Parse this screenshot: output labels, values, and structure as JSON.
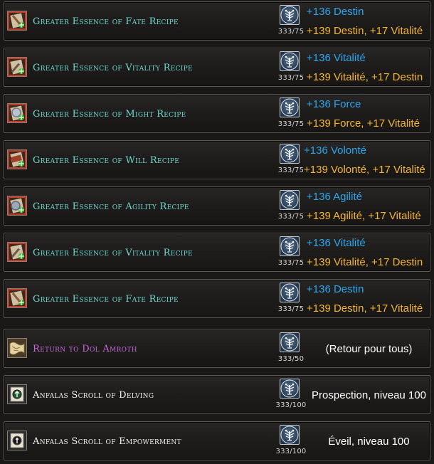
{
  "items": [
    {
      "name": "Greater Essence of Fate Recipe",
      "name_color": "teal",
      "icon": "fate-recipe-icon",
      "emblem": "white-tree-emblem-icon",
      "count": "333/75",
      "bonus1": "+136 Destin",
      "bonus2": "+139 Destin, +17 Vitalité"
    },
    {
      "name": "Greater Essence of Vitality Recipe",
      "name_color": "teal",
      "icon": "vitality-recipe-icon",
      "emblem": "white-tree-emblem-icon",
      "count": "333/75",
      "bonus1": "+136 Vitalité",
      "bonus2": "+139 Vitalité, +17 Destin"
    },
    {
      "name": "Greater Essence of Might Recipe",
      "name_color": "teal",
      "icon": "might-recipe-icon",
      "emblem": "white-tree-emblem-icon",
      "count": "333/75",
      "bonus1": "+136 Force",
      "bonus2": "+139 Force, +17 Vitalité"
    },
    {
      "name": "Greater Essence of Will Recipe",
      "name_color": "teal",
      "icon": "will-recipe-icon",
      "emblem": "white-tree-emblem-icon",
      "count": "333/75",
      "bonus1": "+136 Volonté",
      "bonus2": "+139 Volonté, +17 Vitalité"
    },
    {
      "name": "Greater Essence of Agility Recipe",
      "name_color": "teal",
      "icon": "agility-recipe-icon",
      "emblem": "white-tree-emblem-icon",
      "count": "333/75",
      "bonus1": "+136 Agilité",
      "bonus2": "+139 Agilité, +17 Vitalité"
    },
    {
      "name": "Greater Essence of Vitality Recipe",
      "name_color": "teal",
      "icon": "vitality-recipe-icon",
      "emblem": "white-tree-emblem-icon",
      "count": "333/75",
      "bonus1": "+136 Vitalité",
      "bonus2": "+139 Vitalité, +17 Destin"
    },
    {
      "name": "Greater Essence of Fate Recipe",
      "name_color": "teal",
      "icon": "fate-recipe-icon",
      "emblem": "white-tree-emblem-icon",
      "count": "333/75",
      "bonus1": "+136 Destin",
      "bonus2": "+139 Destin, +17 Vitalité"
    },
    {
      "name": "Return to Dol Amroth",
      "name_color": "purple",
      "icon": "map-scroll-icon",
      "emblem": "white-tree-emblem-icon",
      "count": "333/50",
      "note": "(Retour pour tous)"
    },
    {
      "name": "Anfalas Scroll of Delving",
      "name_color": "white",
      "icon": "delving-scroll-icon",
      "emblem": "white-tree-emblem-icon",
      "count": "333/100",
      "note": "Prospection, niveau 100"
    },
    {
      "name": "Anfalas Scroll of Empowerment",
      "name_color": "white",
      "icon": "empowerment-scroll-icon",
      "emblem": "white-tree-emblem-icon",
      "count": "333/100",
      "note": "Éveil, niveau 100"
    }
  ],
  "colors": {
    "teal": "#6fd7d1",
    "purple": "#c46cdb",
    "white": "#f2f2f2",
    "bonus_blue": "#2aa6f0",
    "bonus_gold": "#f4b530"
  }
}
